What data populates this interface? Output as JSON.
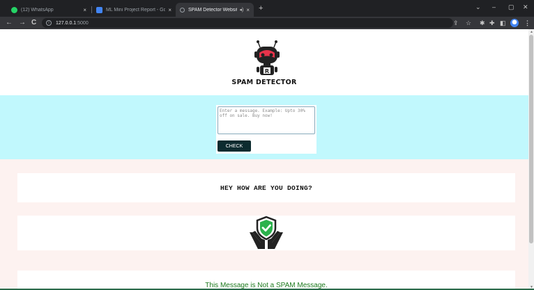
{
  "browser": {
    "tabs": [
      {
        "title": "(12) WhatsApp",
        "color": "#25d366",
        "close": "×"
      },
      {
        "title": "ML Mini Project Report - Google",
        "color": "#4285f4",
        "close": "×"
      },
      {
        "title": "SPAM Detector Website",
        "color": "#9aa0a6",
        "close": "×",
        "active": true
      }
    ],
    "new_tab": "+",
    "window_controls": {
      "dropdown": "⌄",
      "minimize": "–",
      "restore": "▢",
      "close": "✕"
    },
    "nav": {
      "back": "←",
      "forward": "→",
      "reload": "C"
    },
    "url": {
      "host": "127.0.0.1",
      "port": ":5000"
    },
    "right_icons": {
      "share": "⇪",
      "bookmark": "☆",
      "extension": "✱",
      "puzzle": "✚",
      "sidebar": "◧",
      "menu": "⋮"
    }
  },
  "header": {
    "brand": "SPAM DETECTOR"
  },
  "form": {
    "placeholder": "Enter a message. Example: Upto 30% off on sale. Buy now!",
    "button": "CHECK"
  },
  "result": {
    "message": "HEY HOW ARE YOU DOING?",
    "verdict": "This Message is Not a SPAM Message.",
    "verdict_color": "#1d7a1d"
  },
  "colors": {
    "form_band": "#c1f8fd",
    "page_bg": "#fdf2f0",
    "button": "#0c2b2f",
    "shield_green": "#2bb24c"
  }
}
